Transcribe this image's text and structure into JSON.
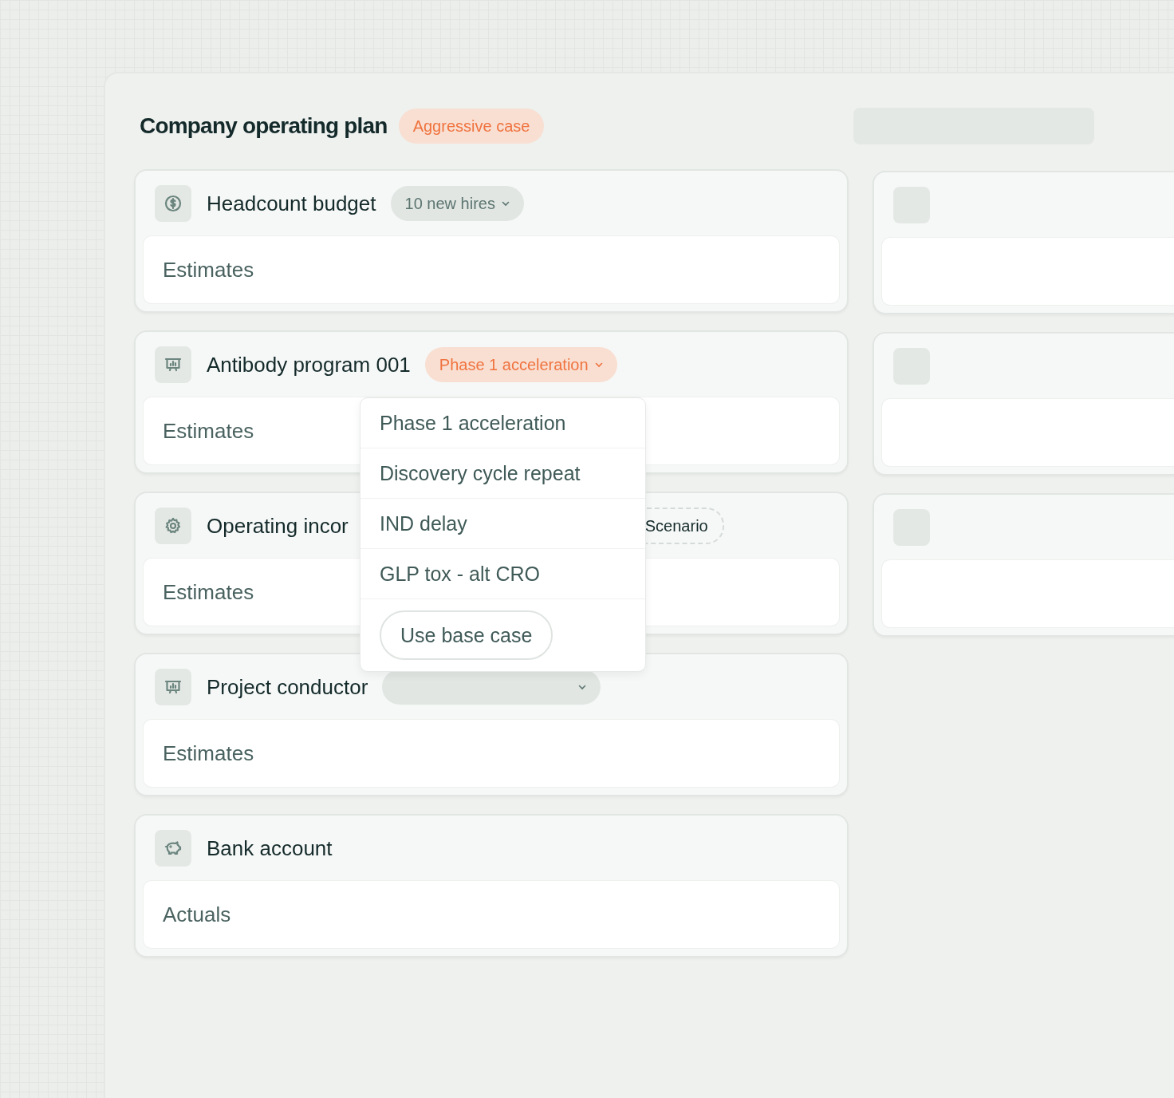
{
  "plan": {
    "title": "Company operating plan",
    "badge": {
      "label": "Aggressive case",
      "kind": "accent"
    }
  },
  "cards": [
    {
      "kind": "dollar",
      "title": "Headcount budget",
      "pill": {
        "label": "10 new hires",
        "kind": "neutral",
        "dropdown": true
      },
      "body": "Estimates"
    },
    {
      "kind": "chart",
      "title": "Antibody program 001",
      "pill": {
        "label": "Phase 1 acceleration",
        "kind": "accent",
        "dropdown": true
      },
      "body": "Estimates",
      "menu": {
        "options": [
          "Phase 1 acceleration",
          "Discovery cycle repeat",
          "IND delay",
          "GLP tox - alt CRO"
        ],
        "button": "Use base case"
      }
    },
    {
      "kind": "gear",
      "title": "Operating incor",
      "pill": {
        "label": "Scenario",
        "kind": "dashed",
        "dropdown": false
      },
      "body": "Estimates"
    },
    {
      "kind": "chart",
      "title": "Project conductor",
      "pill": {
        "kind": "neutral",
        "dropdown": true
      },
      "body": "Estimates"
    },
    {
      "kind": "piggy",
      "title": "Bank account",
      "body": "Actuals"
    }
  ],
  "skeleton_cards": [
    {
      "kind": "skeleton"
    },
    {
      "kind": "skeleton"
    },
    {
      "kind": "skeleton"
    }
  ]
}
